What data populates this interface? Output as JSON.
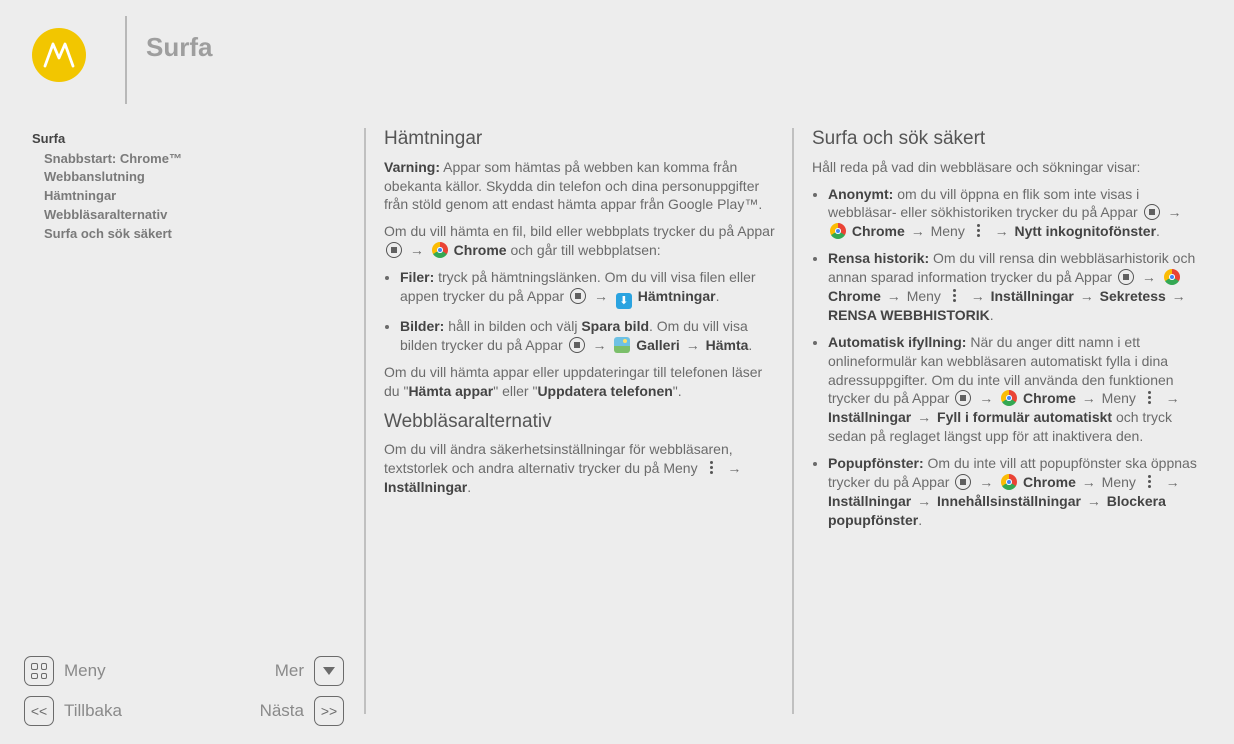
{
  "pageTitle": "Surfa",
  "nav": {
    "head": "Surfa",
    "items": [
      "Snabbstart: Chrome™",
      "Webbanslutning",
      "Hämtningar",
      "Webbläsaralternativ",
      "Surfa och sök säkert"
    ]
  },
  "footer": {
    "menu": "Meny",
    "more": "Mer",
    "back": "Tillbaka",
    "next": "Nästa"
  },
  "col1": {
    "h1": "Hämtningar",
    "p1a": "Varning:",
    "p1b": " Appar som hämtas på webben kan komma från obekanta källor. Skydda din telefon och dina personuppgifter från stöld genom att endast hämta appar från Google Play™.",
    "p2a": "Om du vill hämta en fil, bild eller webbplats trycker du på Appar ",
    "p2b": " Chrome",
    "p2c": " och går till webbplatsen:",
    "li1a": "Filer:",
    "li1b": " tryck på hämtningslänken. Om du vill visa filen eller appen trycker du på Appar ",
    "li1c": " Hämtningar",
    "li1d": ".",
    "li2a": "Bilder:",
    "li2b": " håll in bilden och välj ",
    "li2c": "Spara bild",
    "li2d": ". Om du vill visa bilden trycker du på Appar ",
    "li2e": " Galleri",
    "li2f": "Hämta",
    "p3a": "Om du vill hämta appar eller uppdateringar till telefonen läser du \"",
    "p3b": "Hämta appar",
    "p3c": "\" eller \"",
    "p3d": "Uppdatera telefonen",
    "p3e": "\".",
    "h2": "Webbläsaralternativ",
    "p4a": "Om du vill ändra säkerhetsinställningar för webbläsaren, textstorlek och andra alternativ trycker du på Meny ",
    "p4b": "Inställningar",
    "p4c": "."
  },
  "col2": {
    "h1": "Surfa och sök säkert",
    "intro": "Håll reda på vad din webbläsare och sökningar visar:",
    "li1a": "Anonymt:",
    "li1b": " om du vill öppna en flik som inte visas i webbläsar- eller sökhistoriken trycker du på Appar ",
    "li1c": " Chrome",
    "li1d": " Meny ",
    "li1e": "Nytt inkognitofönster",
    "li2a": "Rensa historik:",
    "li2b": " Om du vill rensa din webbläsarhistorik och annan sparad information trycker du på Appar ",
    "li2c": " Chrome",
    "li2d": " Meny ",
    "li2e": "Inställningar",
    "li2f": "Sekretess",
    "li2g": "RENSA WEBBHISTORIK",
    "li3a": "Automatisk ifyllning:",
    "li3b": " När du anger ditt namn i ett onlineformulär kan webbläsaren automatiskt fylla i dina adressuppgifter. Om du inte vill använda den funktionen trycker du på Appar ",
    "li3c": " Chrome",
    "li3d": " Meny ",
    "li3e": "Inställningar",
    "li3f": "Fyll i formulär automatiskt",
    "li3g": " och tryck sedan på reglaget längst upp för att inaktivera den.",
    "li4a": "Popupfönster:",
    "li4b": " Om du inte vill att popupfönster ska öppnas trycker du på Appar ",
    "li4c": " Chrome",
    "li4d": " Meny ",
    "li4e": "Inställningar",
    "li4f": "Innehållsinställningar",
    "li4g": "Blockera popupfönster"
  }
}
